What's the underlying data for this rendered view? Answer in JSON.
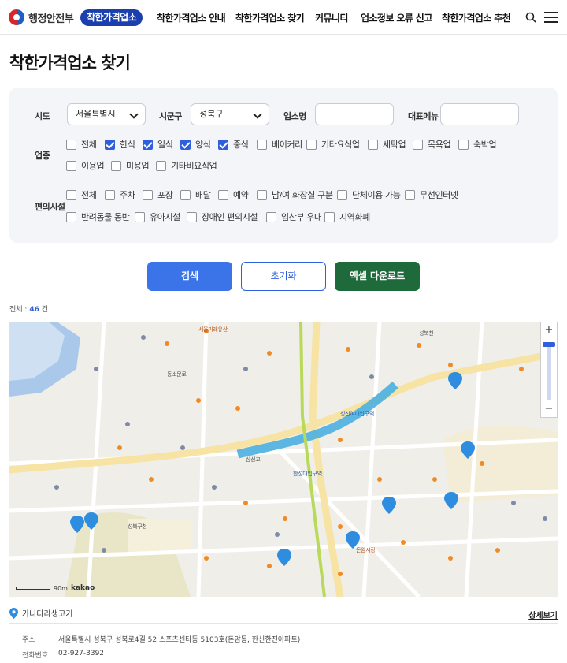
{
  "header": {
    "gov_name": "행정안전부",
    "brand": "착한가격업소",
    "nav": [
      "착한가격업소 안내",
      "착한가격업소 찾기",
      "커뮤니티",
      "업소정보 오류 신고",
      "착한가격업소 추천"
    ]
  },
  "page_title": "착한가격업소 찾기",
  "filters": {
    "sido_label": "시도",
    "sido_value": "서울특별시",
    "sigungu_label": "시군구",
    "sigungu_value": "성북구",
    "name_label": "업소명",
    "menu_label": "대표메뉴",
    "category_label": "업종",
    "categories": [
      {
        "label": "전체",
        "checked": false
      },
      {
        "label": "한식",
        "checked": true
      },
      {
        "label": "일식",
        "checked": true
      },
      {
        "label": "양식",
        "checked": true
      },
      {
        "label": "중식",
        "checked": true
      },
      {
        "label": "베이커리",
        "checked": false
      },
      {
        "label": "기타요식업",
        "checked": false
      },
      {
        "label": "세탁업",
        "checked": false
      },
      {
        "label": "목욕업",
        "checked": false
      },
      {
        "label": "숙박업",
        "checked": false
      },
      {
        "label": "이용업",
        "checked": false
      },
      {
        "label": "미용업",
        "checked": false
      },
      {
        "label": "기타비요식업",
        "checked": false
      }
    ],
    "facility_label": "편의시설",
    "facilities": [
      {
        "label": "전체",
        "checked": false
      },
      {
        "label": "주차",
        "checked": false
      },
      {
        "label": "포장",
        "checked": false
      },
      {
        "label": "배달",
        "checked": false
      },
      {
        "label": "예약",
        "checked": false
      },
      {
        "label": "남/여 화장실 구분",
        "checked": false
      },
      {
        "label": "단체이용 가능",
        "checked": false
      },
      {
        "label": "무선인터넷",
        "checked": false
      },
      {
        "label": "반려동물 동반",
        "checked": false
      },
      {
        "label": "유아시설",
        "checked": false
      },
      {
        "label": "장애인 편의시설",
        "checked": false
      },
      {
        "label": "임산부 우대",
        "checked": false
      },
      {
        "label": "지역화폐",
        "checked": false
      }
    ]
  },
  "buttons": {
    "search": "검색",
    "reset": "초기화",
    "excel": "엑셀 다운로드"
  },
  "total": {
    "prefix": "전체 : ",
    "count": "46",
    "suffix": " 건"
  },
  "map": {
    "scale": "90m",
    "provider": "kakao",
    "labels": [
      "서울미래유산",
      "동소문로",
      "성신여대입구역",
      "성북구청",
      "돈암시장",
      "삼선교",
      "한성대입구역",
      "성북천"
    ]
  },
  "result": {
    "name": "가나다라생고기",
    "detail": "상세보기",
    "address_label": "주소",
    "address": "서울특별시 성북구 성북로4길 52 스포츠센타동 5103호(돈암동, 한신한진아파트)",
    "phone_label": "전화번호",
    "phone": "02-927-3392"
  },
  "colors": {
    "primary": "#3b73e8",
    "excel": "#1f6a3a",
    "brand": "#1b3fae"
  }
}
